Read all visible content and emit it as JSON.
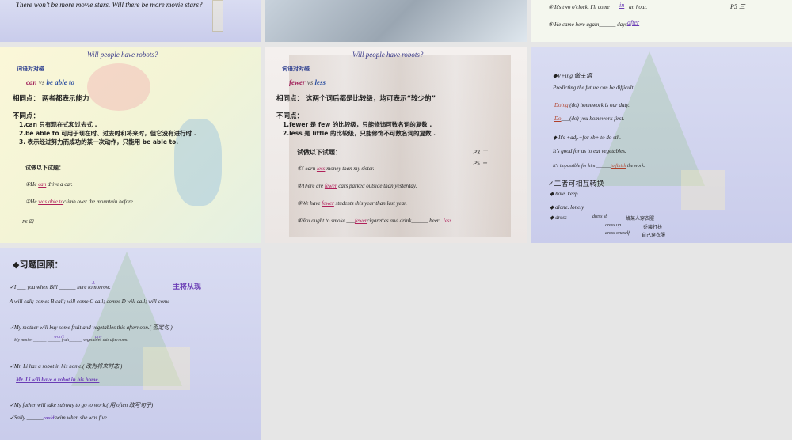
{
  "row1": {
    "slide1": {
      "text": "There won't be more movie stars.  Will there be more movie stars?"
    },
    "slide3": {
      "q4": "④  It's two o'clock, I'll come ______ an hour.",
      "q4_ans": "in",
      "q5": "⑤   He  came  here  again______ days.",
      "q5_ans": "after",
      "ref": "P5  三"
    }
  },
  "slide_can": {
    "title": "Will people have robots?",
    "section": "词语对对碰",
    "word1": "can",
    "vs": "vs",
    "word2": "be able to",
    "same": "相同点：  两者都表示能力",
    "diff_label": "不同点：",
    "diff": [
      "1.can 只有现在式和过去式 .",
      "2.be able to 可用于现在时、过去时和将来时，但它没有进行时 .",
      "3. 表示经过努力而成功的某一次动作，只能用 be able to."
    ],
    "try": "试做以下试题：",
    "q1_pre": "①He ",
    "q1_ans": "can",
    "q1_post": "  drive a car.",
    "q2_pre": "②He ",
    "q2_ans": "was able to",
    "q2_post": "climb over the mountain before.",
    "ref": "P6  四"
  },
  "slide_fewer": {
    "title": "Will people have robots?",
    "section": "词语对对碰",
    "word1": "fewer",
    "vs": "vs",
    "word2": "less",
    "same": "相同点：  这两个词后都是比较级，均可表示“较少的”",
    "diff_label": "不同点：",
    "diff": [
      "1.fewer 是 few 的比较级，只能修饰可数名词的复数 .",
      "2.less 是 little 的比较级，只能修饰不可数名词的复数 ."
    ],
    "try": "试做以下试题：",
    "ref1": "P3  二",
    "ref2": "P5  三",
    "q1_pre": "①I earn ",
    "q1_ans": "less",
    "q1_post": " money than my sister.",
    "q2_pre": "②There are ",
    "q2_ans": "fewer",
    "q2_post": "  cars parked outside than yesterday.",
    "q3_pre": "③We have ",
    "q3_ans": "fewer",
    "q3_post": "  students this year than last year.",
    "q4_pre": "④You ought to smoke ___",
    "q4_ans": "fewer",
    "q4_mid": "cigarettes and drink______ beer . ",
    "q4_ans2": "less"
  },
  "slide_ving": {
    "h1": "◆V+ing  做主语",
    "ex1": "Predicting the future can be difficult.",
    "q1_ans": "Doing",
    "q1": " (do) homework is our duty.",
    "q2_ans": "Do",
    "q2": "___(do) you homework first.",
    "h2": "◆ It's +adj.+for sb+ to do sth.",
    "ex2": "It's good for us to eat vegetables.",
    "q3_pre": "It's impossible for him ______",
    "q3_ans": "to finish",
    "q3_post": " the work.",
    "h3": "✓二者可相互转换",
    "b1": "◆    hate. keep",
    "b2": "◆    alone. lonely",
    "b3": "◆    dress",
    "dress": [
      [
        "dress sb",
        "给某人穿衣服"
      ],
      [
        "dress up",
        "乔装打扮"
      ],
      [
        "dress oneself",
        "自己穿衣服"
      ]
    ]
  },
  "slide_review": {
    "title": "◆习题回顾：",
    "q1": "✓I ___ you when Bill ______ here tomorrow.",
    "q1_ans": "A",
    "note": "主将从现",
    "q1_opts": "A will call; comes   B call; will come  C call; comes   D will call; will come",
    "q2": "✓My mother will buy some fruit and vegetables this afternoon.( 否定句 )",
    "q2_fill": "My mother______ ______ fruit______ vegetables this afternoon.",
    "q2_ans1": "won't",
    "q2_ans2": "any",
    "q3": "✓Mr. Li has a robot in his home.( 改为将来时态 )",
    "q3_ans": "Mr. Li will have a robot in his home.",
    "q4": "✓My father will take subway to go to work.( 用  often 改写句子)",
    "q5_pre": "✓Sally ______",
    "q5_ans": "could",
    "q5_post": "swim when she was five."
  }
}
